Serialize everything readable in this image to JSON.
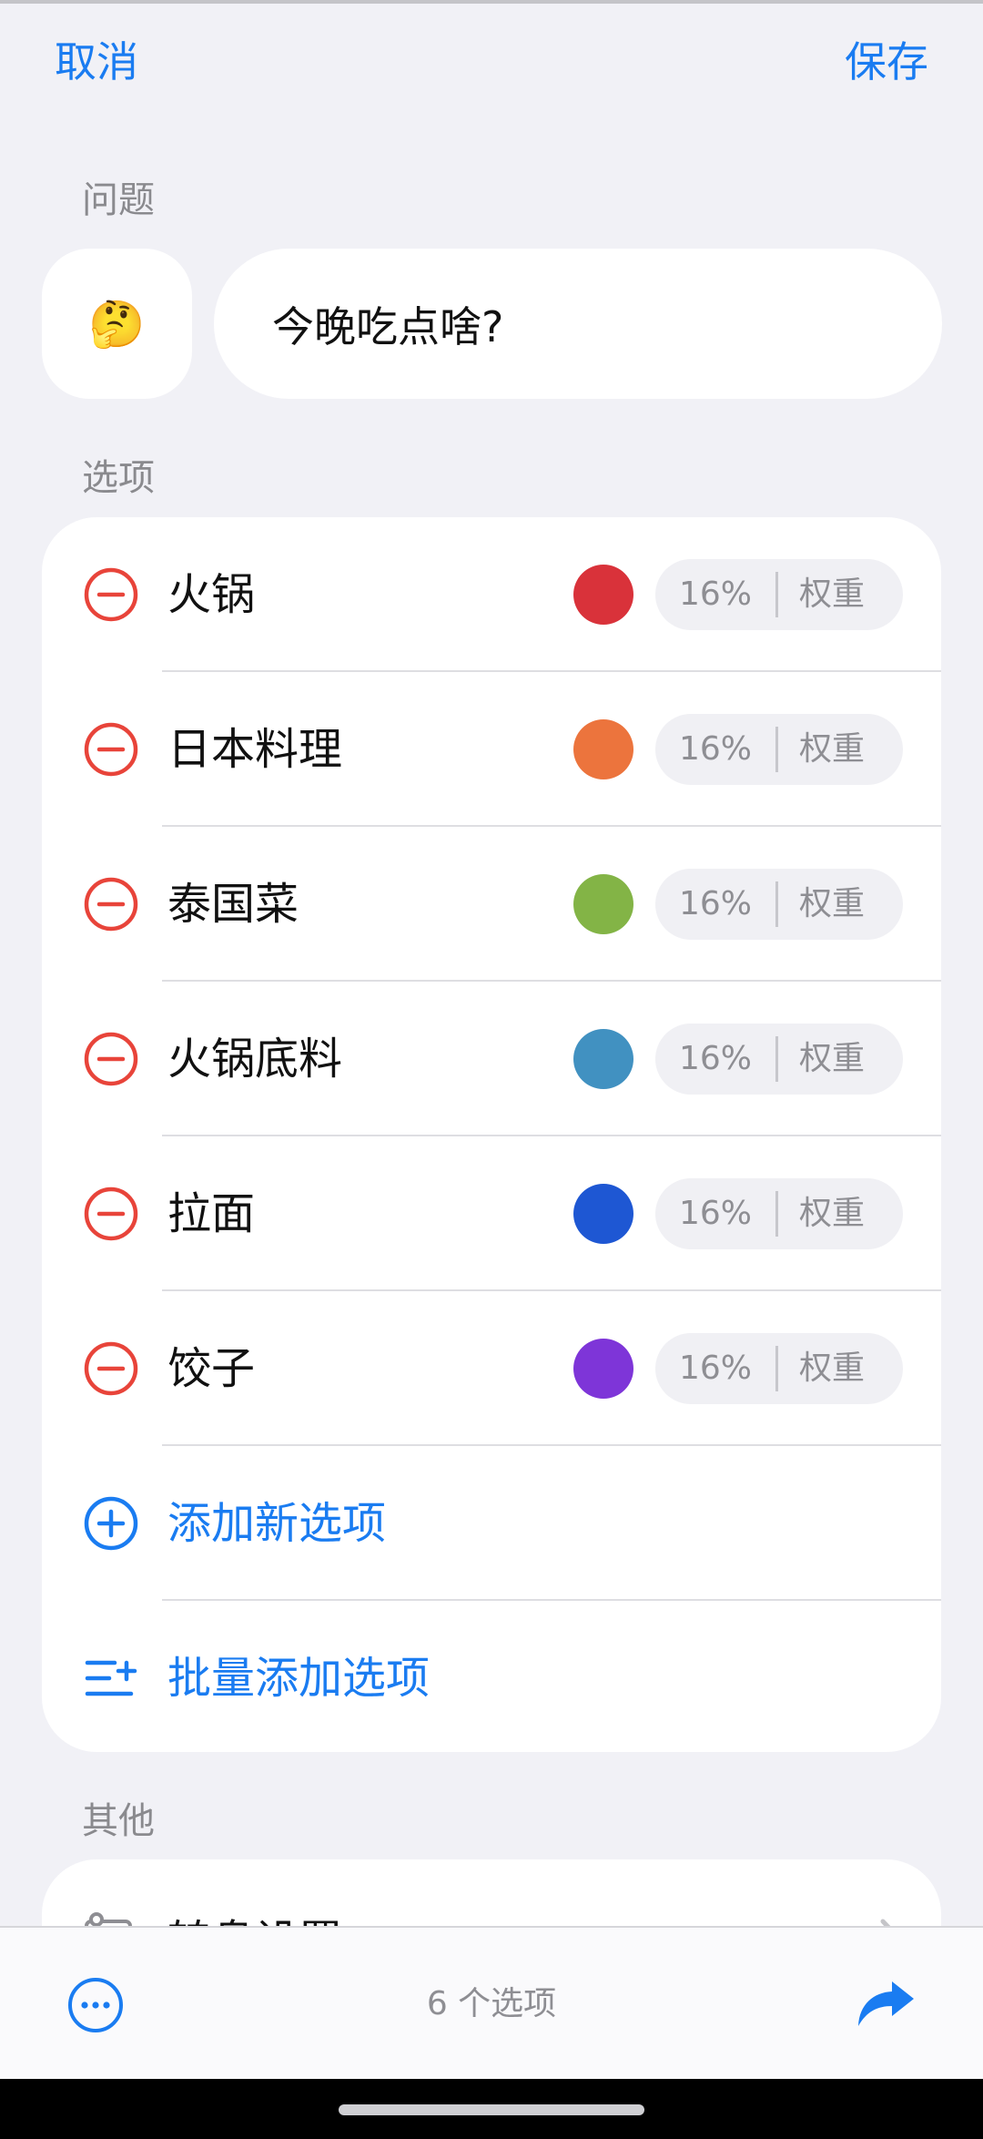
{
  "nav": {
    "cancel": "取消",
    "save": "保存"
  },
  "question": {
    "section_label": "问题",
    "emoji": "🤔",
    "text": "今晚吃点啥?"
  },
  "options": {
    "section_label": "选项",
    "items": [
      {
        "label": "火锅",
        "color": "#d9323a",
        "percent": "16%",
        "weight_label": "权重"
      },
      {
        "label": "日本料理",
        "color": "#ec743d",
        "percent": "16%",
        "weight_label": "权重"
      },
      {
        "label": "泰国菜",
        "color": "#83b446",
        "percent": "16%",
        "weight_label": "权重"
      },
      {
        "label": "火锅底料",
        "color": "#4191c1",
        "percent": "16%",
        "weight_label": "权重"
      },
      {
        "label": "拉面",
        "color": "#1e57d3",
        "percent": "16%",
        "weight_label": "权重"
      },
      {
        "label": "饺子",
        "color": "#7e35d8",
        "percent": "16%",
        "weight_label": "权重"
      }
    ],
    "add_label": "添加新选项",
    "batch_add_label": "批量添加选项"
  },
  "other": {
    "section_label": "其他",
    "item_label": "转盘设置"
  },
  "bottom": {
    "count_text": "6 个选项"
  },
  "colors": {
    "accent": "#1a7cf1",
    "destructive": "#e8443a"
  },
  "icons": [
    "minus-circle-icon",
    "plus-circle-icon",
    "batch-list-icon",
    "more-icon",
    "share-icon",
    "settings-icon",
    "chevron-right-icon"
  ]
}
